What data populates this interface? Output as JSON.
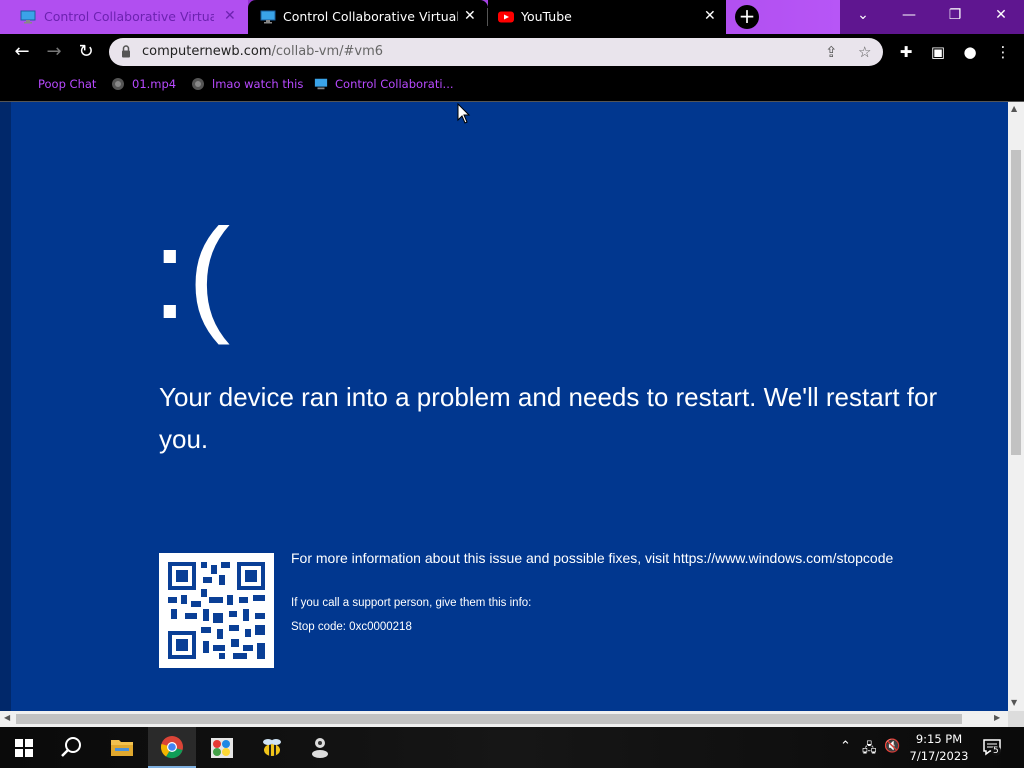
{
  "browser": {
    "tabs": [
      {
        "title": "Control Collaborative Virtual Machine",
        "icon": "monitor-icon",
        "active": true
      },
      {
        "title": "Control Collaborative Virtual Machine",
        "icon": "monitor-icon",
        "active": false
      },
      {
        "title": "YouTube",
        "icon": "youtube-icon",
        "active": false
      }
    ],
    "new_tab_symbol": "+",
    "url_host": "computernewb.com",
    "url_path": "/collab-vm/#vm6",
    "bookmarks": [
      {
        "label": "Poop Chat",
        "icon": "none"
      },
      {
        "label": "01.mp4",
        "icon": "globe-icon"
      },
      {
        "label": "lmao watch this",
        "icon": "globe-icon"
      },
      {
        "label": "Control Collaborati...",
        "icon": "monitor-icon"
      }
    ],
    "theme_color": "#b14ff0"
  },
  "bsod": {
    "face": ":(",
    "message": "Your device ran into a problem and needs to restart. We'll restart for you.",
    "info_line": "For more information about this issue and possible fixes, visit https://www.windows.com/stopcode",
    "support_line": "If you call a support person, give them this info:",
    "stop_code": "Stop code: 0xc0000218",
    "background_color": "#01378f"
  },
  "taskbar": {
    "apps": [
      "start-button",
      "search-button",
      "file-explorer-icon",
      "chrome-icon",
      "paint-icon",
      "bee-app-icon",
      "user-app-icon"
    ],
    "time": "9:15 PM",
    "date": "7/17/2023",
    "notification_count": "5"
  }
}
